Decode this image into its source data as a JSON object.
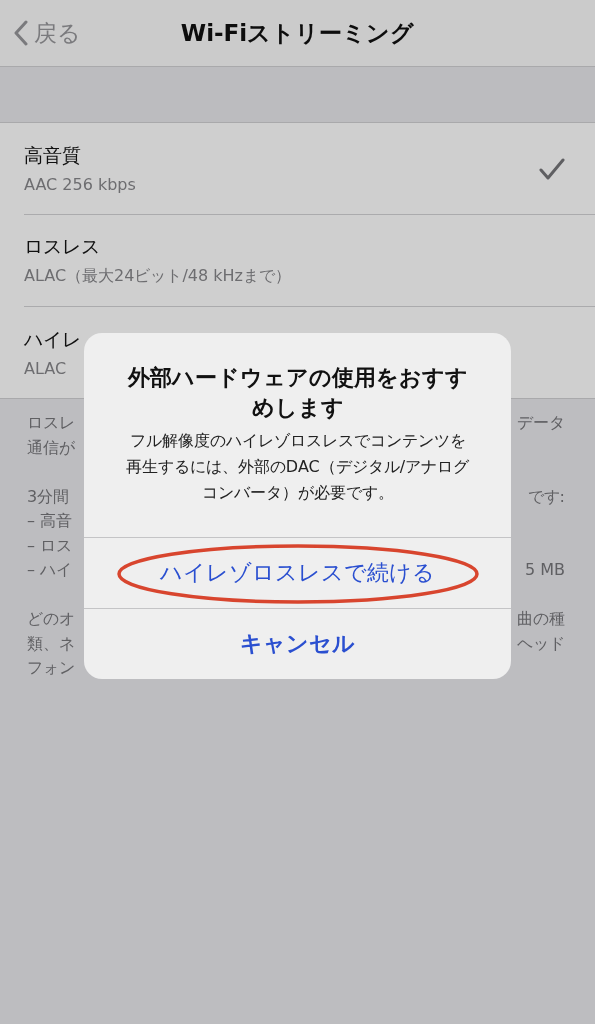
{
  "nav": {
    "back": "戻る",
    "title": "Wi-Fiストリーミング"
  },
  "options": [
    {
      "title": "高音質",
      "subtitle": "AAC 256 kbps",
      "selected": true
    },
    {
      "title": "ロスレス",
      "subtitle": "ALAC（最大24ビット/48 kHzまで）",
      "selected": false
    },
    {
      "title": "ハイレ",
      "subtitle": "ALAC",
      "selected": false
    }
  ],
  "footer_paragraphs": [
    {
      "lines": [
        {
          "left": "ロスレ",
          "right": "データ"
        },
        {
          "left": "通信が"
        }
      ]
    },
    {
      "lines": [
        {
          "left": "3分間",
          "right": "です:"
        },
        {
          "left": "– 高音"
        },
        {
          "left": "– ロス"
        },
        {
          "left": "– ハイ",
          "right": "5 MB"
        }
      ]
    },
    {
      "lines": [
        {
          "left": "どのオ",
          "right": "曲の種"
        },
        {
          "left": "類、ネ",
          "right": "ヘッド"
        },
        {
          "left": "フォン"
        }
      ]
    }
  ],
  "alert": {
    "title": "外部ハードウェアの使用をおすすめします",
    "message": "フル解像度のハイレゾロスレスでコンテンツを再生するには、外部のDAC（デジタル/アナログコンバータ）が必要です。",
    "actions": [
      {
        "label": "ハイレゾロスレスで続ける",
        "bold": false,
        "highlighted": true
      },
      {
        "label": "キャンセル",
        "bold": true,
        "highlighted": false
      }
    ]
  }
}
